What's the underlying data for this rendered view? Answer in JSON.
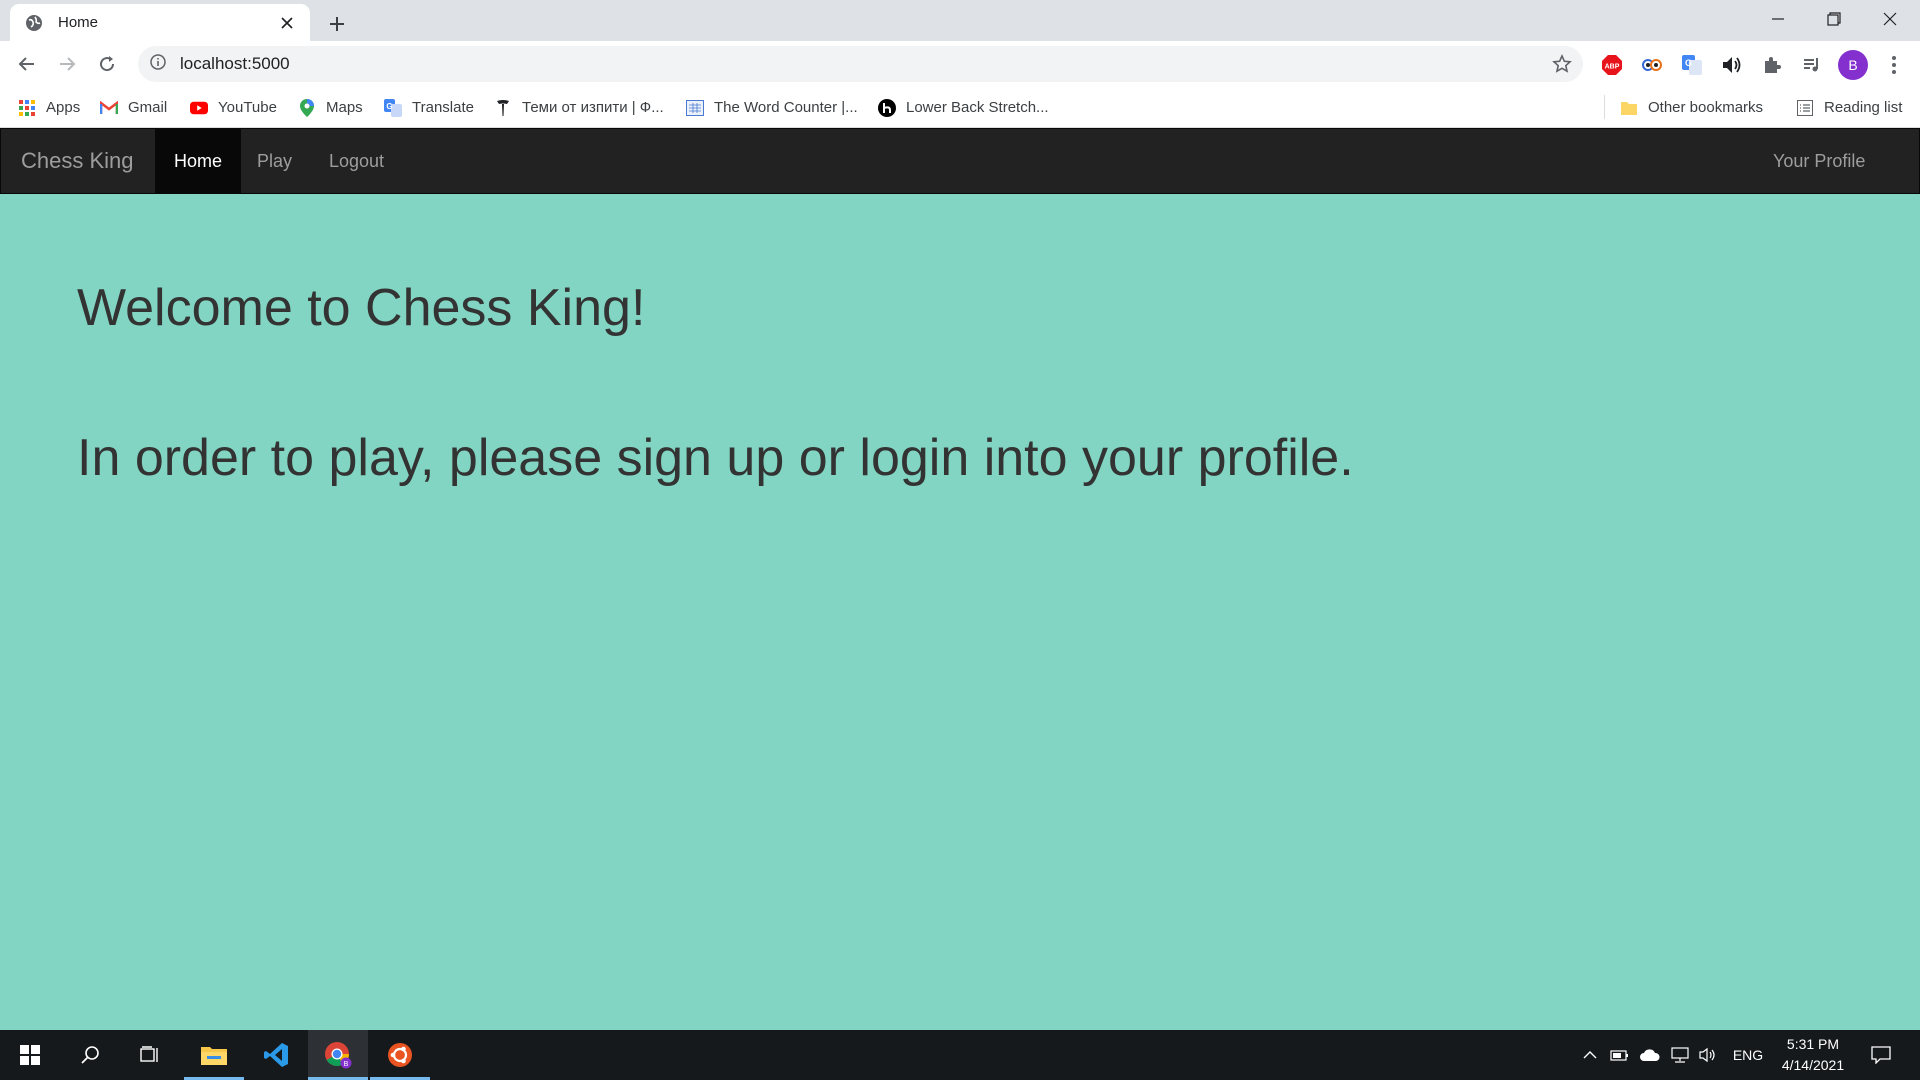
{
  "browser": {
    "tab_title": "Home",
    "url": "localhost:5000",
    "profile_initial": "B"
  },
  "bookmarks": [
    {
      "label": "Apps",
      "icon": "apps-grid-icon"
    },
    {
      "label": "Gmail",
      "icon": "gmail-icon"
    },
    {
      "label": "YouTube",
      "icon": "youtube-icon"
    },
    {
      "label": "Maps",
      "icon": "maps-icon"
    },
    {
      "label": "Translate",
      "icon": "translate-icon"
    },
    {
      "label": "Теми от изпити | Ф...",
      "icon": "tesla-icon"
    },
    {
      "label": "The Word Counter |...",
      "icon": "word-counter-icon"
    },
    {
      "label": "Lower Back Stretch...",
      "icon": "bodybuilding-icon"
    }
  ],
  "bookmarks_right": {
    "other": "Other bookmarks",
    "reading": "Reading list"
  },
  "navbar": {
    "brand": "Chess King",
    "links": [
      "Home",
      "Play",
      "Logout"
    ],
    "active": "Home",
    "profile": "Your Profile"
  },
  "main": {
    "heading": "Welcome to Chess King!",
    "message": "In order to play, please sign up or login into your profile."
  },
  "taskbar": {
    "language": "ENG",
    "time": "5:31 PM",
    "date": "4/14/2021"
  },
  "colors": {
    "page_bg": "#82d5c3",
    "navbar_bg": "#222222",
    "text": "#333333",
    "profile_avatar": "#8430ce"
  }
}
